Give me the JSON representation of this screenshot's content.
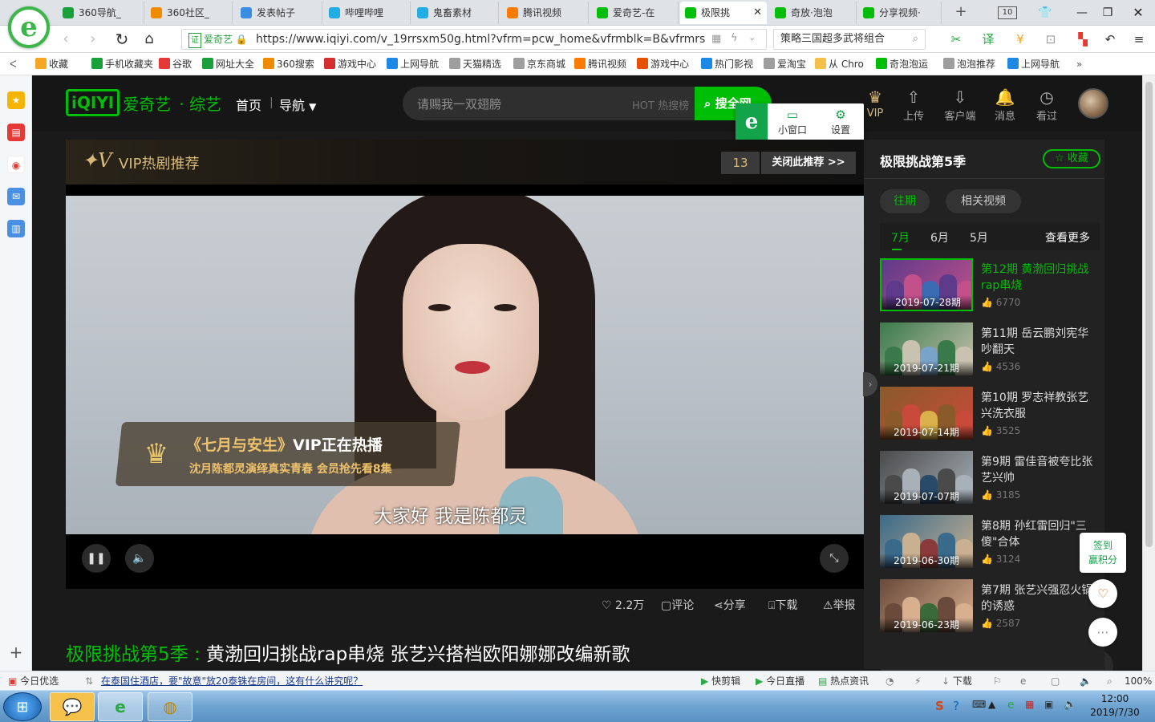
{
  "browser": {
    "tabs": [
      {
        "label": "360导航_",
        "icon": "360-nav-icon",
        "color": "#1aa03b"
      },
      {
        "label": "360社区_",
        "icon": "360-community-icon",
        "color": "#f08a00"
      },
      {
        "label": "发表帖子",
        "icon": "post-icon",
        "color": "#3a8de0"
      },
      {
        "label": "哔哩哔哩",
        "icon": "bilibili-icon",
        "color": "#23ade5"
      },
      {
        "label": "鬼畜素材",
        "icon": "bilibili-icon",
        "color": "#23ade5"
      },
      {
        "label": "腾讯视频",
        "icon": "tencent-video-icon",
        "color": "#ff7b00"
      },
      {
        "label": "爱奇艺-在",
        "icon": "iqiyi-icon",
        "color": "#00be06"
      },
      {
        "label": "极限挑",
        "icon": "iqiyi-icon",
        "color": "#00be06",
        "active": true
      },
      {
        "label": "奇放·泡泡",
        "icon": "iqiyi-icon",
        "color": "#00be06"
      },
      {
        "label": "分享视频·",
        "icon": "iqiyi-icon",
        "color": "#00be06"
      }
    ],
    "tab_count": "10",
    "cert_label": "证",
    "cert_site": "爱奇艺",
    "url": "https://www.iqiyi.com/v_19rrsxm50g.html?vfrm=pcw_home&vfrmblk=B&vfrmrst=f",
    "search_text": "策略三国超多武将组合",
    "bookmarks": [
      {
        "label": "收藏",
        "icon": "star-icon",
        "color": "#f5a623"
      },
      {
        "label": "手机收藏夹",
        "icon": "phone-icon",
        "color": "#1aa03b"
      },
      {
        "label": "谷歌",
        "icon": "google-icon",
        "color": "#e53935"
      },
      {
        "label": "网址大全",
        "icon": "360-nav-icon",
        "color": "#1aa03b"
      },
      {
        "label": "360搜索",
        "icon": "360-search-icon",
        "color": "#f08a00"
      },
      {
        "label": "游戏中心",
        "icon": "game-center-icon",
        "color": "#d32f2f"
      },
      {
        "label": "上网导航",
        "icon": "ie-icon",
        "color": "#1e88e5"
      },
      {
        "label": "天猫精选",
        "icon": "tmall-icon",
        "color": "#9e9e9e"
      },
      {
        "label": "京东商城",
        "icon": "page-icon",
        "color": "#9e9e9e"
      },
      {
        "label": "腾讯视频",
        "icon": "tencent-video-icon",
        "color": "#ff7b00"
      },
      {
        "label": "游戏中心",
        "icon": "gamepad-icon",
        "color": "#e65100"
      },
      {
        "label": "热门影视",
        "icon": "play-icon",
        "color": "#1e88e5"
      },
      {
        "label": "爱淘宝",
        "icon": "page-icon",
        "color": "#9e9e9e"
      },
      {
        "label": "从 Chro",
        "icon": "folder-icon",
        "color": "#f5c04a"
      },
      {
        "label": "奇泡泡运",
        "icon": "iqiyi-icon",
        "color": "#00be06"
      },
      {
        "label": "泡泡推荐",
        "icon": "page-icon",
        "color": "#9e9e9e"
      },
      {
        "label": "上网导航",
        "icon": "ie-icon",
        "color": "#1e88e5"
      }
    ],
    "more_label": "»"
  },
  "site": {
    "logo_text": "iQIYI",
    "logo_name": "爱奇艺",
    "section": "· 综艺",
    "nav_home": "首页",
    "nav_guide": "导航",
    "search_placeholder": "请赐我一双翅膀",
    "hot_rank": "HOT 热搜榜",
    "search_btn": "搜全网",
    "popup_mini": "小窗口",
    "popup_settings": "设置",
    "header_icons": [
      {
        "label": "VIP",
        "icon": "crown-icon"
      },
      {
        "label": "上传",
        "icon": "upload-icon"
      },
      {
        "label": "客户端",
        "icon": "download-client-icon"
      },
      {
        "label": "消息",
        "icon": "bell-icon"
      },
      {
        "label": "看过",
        "icon": "history-icon"
      }
    ]
  },
  "player": {
    "vip_banner": "VIP热剧推荐",
    "countdown": "13",
    "close_rec": "关闭此推荐 >>",
    "promo_title_em": "《七月与安生》",
    "promo_title": "VIP正在热播",
    "promo_sub": "沈月陈都灵演绎真实青春 会员抢先看8集",
    "subtitle": "大家好  我是陈都灵"
  },
  "actions": {
    "likes": "2.2万",
    "comment": "评论",
    "share": "分享",
    "download": "下载",
    "report": "举报"
  },
  "video_title": {
    "series": "极限挑战第5季 :",
    "episode": "黄渤回归挑战rap串烧 张艺兴搭档欧阳娜娜改编新歌"
  },
  "panel": {
    "title": "极限挑战第5季",
    "fav": "收藏",
    "pill_past": "往期",
    "pill_related": "相关视频",
    "months": [
      "7月",
      "6月",
      "5月"
    ],
    "more": "查看更多",
    "episodes": [
      {
        "title": "第12期 黄渤回归挑战rap串烧",
        "date": "2019-07-28期",
        "views": "6770",
        "selected": true
      },
      {
        "title": "第11期 岳云鹏刘宪华吵翻天",
        "date": "2019-07-21期",
        "views": "4536"
      },
      {
        "title": "第10期 罗志祥教张艺兴洗衣服",
        "date": "2019-07-14期",
        "views": "3525"
      },
      {
        "title": "第9期 雷佳音被夸比张艺兴帅",
        "date": "2019-07-07期",
        "views": "3185"
      },
      {
        "title": "第8期 孙红雷回归\"三傻\"合体",
        "date": "2019-06-30期",
        "views": "3124"
      },
      {
        "title": "第7期 张艺兴强忍火锅的诱惑",
        "date": "2019-06-23期",
        "views": "2587"
      }
    ],
    "checkin": "签到\n赢积分"
  },
  "statusbar": {
    "today_picks": "今日优选",
    "news": "在泰国住酒店，要\"故意\"放20泰铢在房间，这有什么讲究呢？",
    "quick_cut": "快剪辑",
    "live": "今日直播",
    "hot_news": "热点资讯",
    "download": "下载",
    "zoom": "100%"
  },
  "taskbar": {
    "time": "12:00",
    "date": "2019/7/30"
  }
}
